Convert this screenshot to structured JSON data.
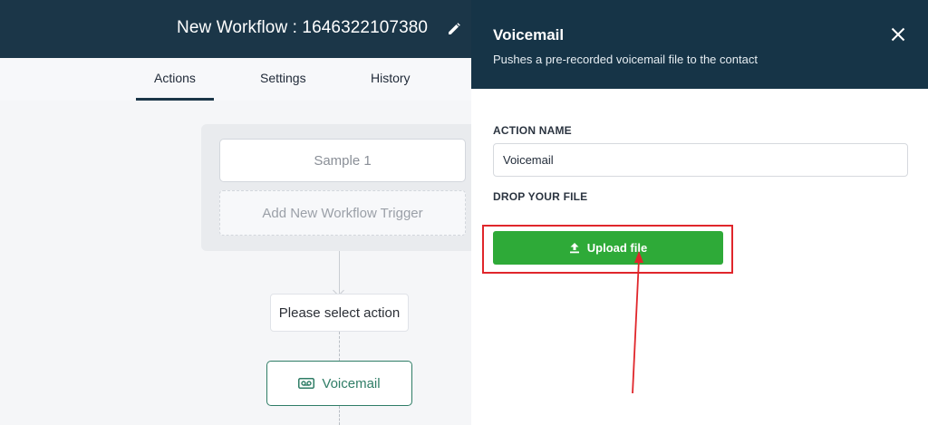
{
  "workflow": {
    "title": "New Workflow : 1646322107380"
  },
  "tabs": [
    {
      "label": "Actions",
      "active": true
    },
    {
      "label": "Settings",
      "active": false
    },
    {
      "label": "History",
      "active": false
    }
  ],
  "canvas": {
    "trigger_label": "Sample 1",
    "add_trigger_label": "Add New Workflow Trigger",
    "select_action_label": "Please select action",
    "action_node_label": "Voicemail"
  },
  "panel": {
    "title": "Voicemail",
    "subtitle": "Pushes a pre-recorded voicemail file to the contact",
    "action_name_label": "ACTION NAME",
    "action_name_value": "Voicemail",
    "drop_file_label": "DROP YOUR FILE",
    "upload_label": "Upload file"
  },
  "colors": {
    "header_bg": "#1b3648",
    "accent_green": "#2eaa38",
    "node_green": "#2f7d66",
    "annotation_red": "#e0262b"
  },
  "icons": {
    "edit": "pencil-icon",
    "close": "close-icon",
    "upload": "upload-icon",
    "voicemail": "voicemail-icon"
  }
}
